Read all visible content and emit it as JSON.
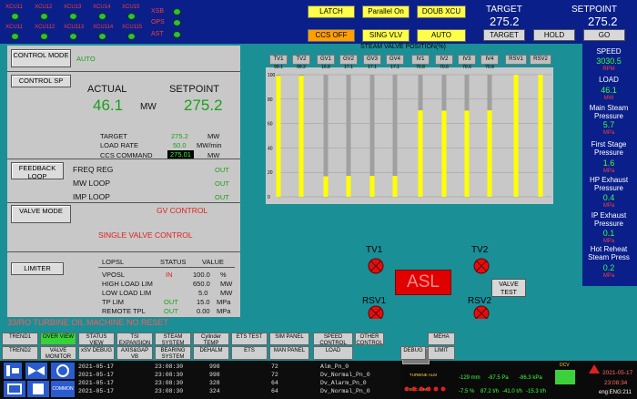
{
  "header": {
    "xcu_row1": [
      "XCU11",
      "XCU12",
      "XCU13",
      "XCU14",
      "XCU15"
    ],
    "xcu_row2": [
      "XCU11",
      "XCU112",
      "XCU113",
      "XCU114",
      "XCU115"
    ],
    "indicators": [
      "XSB",
      "OPS",
      "AST"
    ],
    "btn_latch": "LATCH",
    "btn_parallel": "Parallel On",
    "btn_doub": "DOUB XCU",
    "btn_ccs": "CCS OFF",
    "btn_sing": "SING VLV",
    "btn_auto": "AUTO",
    "target_label": "TARGET",
    "target_value": "275.2",
    "setpoint_label": "SETPOINT",
    "setpoint_value": "275.2",
    "btn_target": "TARGET",
    "btn_hold": "HOLD",
    "btn_go": "GO"
  },
  "left": {
    "control_mode_btn": "CONTROL MODE",
    "control_mode_val": "AUTO",
    "control_sp_btn": "CONTROL SP",
    "actual_label": "ACTUAL",
    "setpoint_label": "SETPOINT",
    "actual_value": "46.1",
    "unit_mw": "MW",
    "setpoint_value": "275.2",
    "target_label": "TARGET",
    "target_value": "275.2",
    "target_unit": "MW",
    "loadrate_label": "LOAD RATE",
    "loadrate_value": "50.0",
    "loadrate_unit": "MW/min",
    "ccs_label": "CCS COMMAND",
    "ccs_value": "275.01",
    "ccs_unit": "MW",
    "feedback_btn": "FEEDBACK LOOP",
    "freq_label": "FREQ REG",
    "freq_val": "OUT",
    "mw_label": "MW LOOP",
    "mw_val": "OUT",
    "imp_label": "IMP LOOP",
    "imp_val": "OUT",
    "valve_btn": "VALVE MODE",
    "gv_control": "GV CONTROL",
    "single_valve": "SINGLE VALVE CONTROL",
    "limiter_btn": "LIMITER",
    "lim_headers": [
      "LOPSL",
      "STATUS",
      "VALUE"
    ],
    "limits": [
      {
        "name": "VPOSL",
        "status": "IN",
        "value": "100.0",
        "unit": "%"
      },
      {
        "name": "HIGH LOAD LIM",
        "status": "",
        "value": "650.0",
        "unit": "MW"
      },
      {
        "name": "LOW LOAD LIM",
        "status": "",
        "value": "5.0",
        "unit": "MW"
      },
      {
        "name": "TP LIM",
        "status": "OUT",
        "value": "15.0",
        "unit": "MPa"
      },
      {
        "name": "REMOTE TPL",
        "status": "OUT",
        "value": "0.00",
        "unit": "MPa"
      }
    ]
  },
  "alarm_line": "33/RO TURBINE OIL MACHINE NO RESET",
  "valve_chart": {
    "title": "STEAM VALVE POSITION(%)",
    "tags": [
      "TV1",
      "TV2",
      "GV1",
      "GV2",
      "GV3",
      "GV4",
      "IV1",
      "IV2",
      "IV3",
      "IV4",
      "RSV1",
      "RSV2"
    ],
    "values": [
      "99.1",
      "99.2",
      "16.8",
      "17.1",
      "17.1",
      "17.1",
      "70.8",
      "70.6",
      "70.6",
      "70.8",
      "",
      ""
    ],
    "y_ticks": [
      "100",
      "80",
      "60",
      "40",
      "20",
      "0"
    ]
  },
  "chart_data": {
    "type": "bar",
    "title": "STEAM VALVE POSITION(%)",
    "categories": [
      "TV1",
      "TV2",
      "GV1",
      "GV2",
      "GV3",
      "GV4",
      "IV1",
      "IV2",
      "IV3",
      "IV4",
      "RSV1",
      "RSV2"
    ],
    "values": [
      99.1,
      99.2,
      16.8,
      17.1,
      17.1,
      17.1,
      70.8,
      70.6,
      70.6,
      70.8,
      100,
      100
    ],
    "ylim": [
      0,
      100
    ]
  },
  "valves": {
    "tv1": "TV1",
    "tv2": "TV2",
    "rsv1": "RSV1",
    "rsv2": "RSV2",
    "asl": "ASL",
    "valve_test": "VALVE TEST"
  },
  "right": {
    "speed_label": "SPEED",
    "speed_value": "3030.5",
    "speed_unit": "RPM",
    "load_label": "LOAD",
    "load_value": "46.1",
    "load_unit": "MW",
    "msp_label": "Main Steam Pressure",
    "msp_value": "5.7",
    "msp_unit": "MPa",
    "fsp_label": "First Stage Pressure",
    "fsp_value": "1.6",
    "fsp_unit": "MPa",
    "hpe_label": "HP Exhaust Pressure",
    "hpe_value": "0.4",
    "hpe_unit": "MPa",
    "ipe_label": "IP Exhaust Pressure",
    "ipe_value": "0.1",
    "ipe_unit": "MPa",
    "hrs_label": "Hot Reheat Steam Press",
    "hrs_value": "0.2",
    "hrs_unit": "MPa"
  },
  "nav": {
    "row1": [
      "TREND1",
      "OVER VIEW",
      "STATUS VIEW",
      "TSI EXPANSION",
      "STEAM SYSTEM",
      "Cylinder TEMP",
      "ETS TEST",
      "SIM PANEL",
      "SPEED CONTROL",
      "OTHER CONTROL",
      "MEHA"
    ],
    "row2": [
      "TREND2",
      "VALVE MONITOR",
      "xSV DEBUG",
      "AXIS&GAP VB",
      "BEARING SYSTEM",
      "DEHALM",
      "ETS",
      "MAN PANEL",
      "LOAD",
      "",
      "DEBUG",
      "LIMIT"
    ]
  },
  "alarms": {
    "rows": [
      {
        "date": "2021-05-17",
        "time": "23:08:30",
        "code": "998",
        "n": "72",
        "text": "Alm_Pn_0"
      },
      {
        "date": "2021-05-17",
        "time": "23:08:30",
        "code": "998",
        "n": "72",
        "text": "Dv_Normal_Pn_0"
      },
      {
        "date": "2021-05-17",
        "time": "23:08:30",
        "code": "328",
        "n": "64",
        "text": "Dv_Alarm_Pn_0"
      },
      {
        "date": "2021-05-17",
        "time": "23:08:30",
        "code": "324",
        "n": "64",
        "text": "Dv_Normal_Pn_0"
      }
    ],
    "common_label": "COMMON"
  },
  "status_right": {
    "turbine_alm": "TURBINE ALM",
    "elc_alm": "ELC ALM",
    "v1": "-129 mm",
    "v2": "-87.5 Pa",
    "v3": "-86.3 kPa",
    "v4": "-7.5 %",
    "v5": "87.2 t/h",
    "v6": "-41.0 t/h",
    "v7": "-15.3 t/h",
    "dcv": "DCV",
    "date": "2021-05-17",
    "time": "23:08:34",
    "lang": "eng:ENG:211"
  },
  "colors": {
    "bg": "#1a8f96",
    "header": "#0a1f8a",
    "bar": "#ffff00",
    "panel": "#c8c8c8",
    "asl": "#e00000"
  }
}
